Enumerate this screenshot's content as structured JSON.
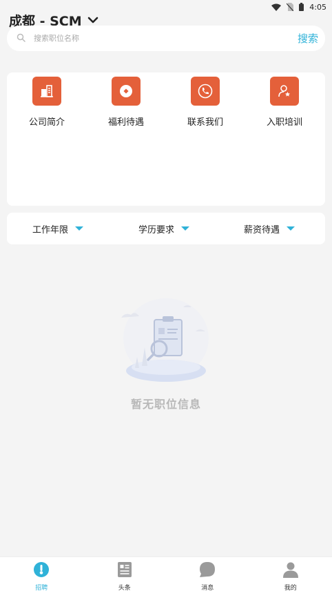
{
  "status_bar": {
    "time": "4:05",
    "icons": [
      "wifi-icon",
      "no-sim-icon",
      "battery-icon"
    ]
  },
  "header": {
    "city": "成都 - SCM",
    "dropdown_icon": "chevron-down-icon"
  },
  "search": {
    "placeholder": "搜索职位名称",
    "button_label": "搜索"
  },
  "menu": {
    "items": [
      {
        "label": "公司简介",
        "icon": "building-icon"
      },
      {
        "label": "福利待遇",
        "icon": "coin-icon"
      },
      {
        "label": "联系我们",
        "icon": "phone-icon"
      },
      {
        "label": "入职培训",
        "icon": "user-star-icon"
      }
    ]
  },
  "filters": {
    "items": [
      {
        "label": "工作年限"
      },
      {
        "label": "学历要求"
      },
      {
        "label": "薪资待遇"
      }
    ]
  },
  "empty_state": {
    "text": "暂无职位信息",
    "icon": "empty-clipboard-illustration"
  },
  "tabbar": {
    "tabs": [
      {
        "label": "招聘",
        "icon": "recruit-icon",
        "active": true
      },
      {
        "label": "头条",
        "icon": "news-icon",
        "active": false
      },
      {
        "label": "消息",
        "icon": "message-icon",
        "active": false
      },
      {
        "label": "我的",
        "icon": "profile-icon",
        "active": false
      }
    ]
  },
  "colors": {
    "accent": "#2fb2d8",
    "menu_icon_bg": "#e4603a",
    "page_bg": "#f4f4f4"
  }
}
